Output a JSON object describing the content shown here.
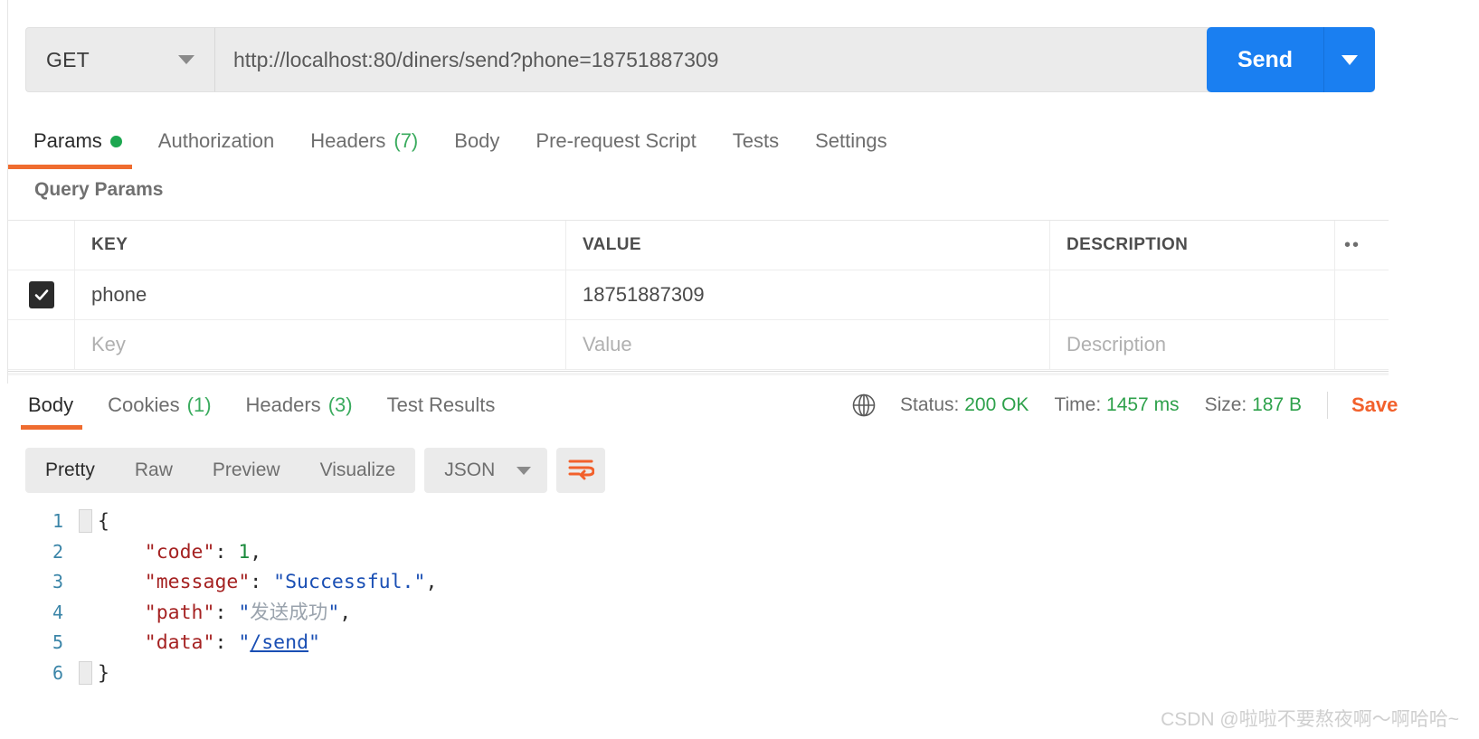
{
  "request": {
    "method": "GET",
    "method_caret_icon": "chevron-down-icon",
    "url": "http://localhost:80/diners/send?phone=18751887309",
    "send_label": "Send",
    "send_caret_icon": "chevron-down-icon"
  },
  "request_tabs": [
    {
      "label": "Params",
      "badge": "",
      "dot": true,
      "active": true
    },
    {
      "label": "Authorization",
      "badge": "",
      "dot": false,
      "active": false
    },
    {
      "label": "Headers",
      "badge": "(7)",
      "dot": false,
      "active": false
    },
    {
      "label": "Body",
      "badge": "",
      "dot": false,
      "active": false
    },
    {
      "label": "Pre-request Script",
      "badge": "",
      "dot": false,
      "active": false
    },
    {
      "label": "Tests",
      "badge": "",
      "dot": false,
      "active": false
    },
    {
      "label": "Settings",
      "badge": "",
      "dot": false,
      "active": false
    }
  ],
  "query_params": {
    "section_title": "Query Params",
    "columns": [
      "KEY",
      "VALUE",
      "DESCRIPTION"
    ],
    "bulk_edit_icon": "ellipsis-icon",
    "rows": [
      {
        "checked": true,
        "key": "phone",
        "value": "18751887309",
        "description": ""
      }
    ],
    "placeholder_row": {
      "key": "Key",
      "value": "Value",
      "description": "Description"
    }
  },
  "response_tabs": [
    {
      "label": "Body",
      "badge": "",
      "active": true
    },
    {
      "label": "Cookies",
      "badge": "(1)",
      "active": false
    },
    {
      "label": "Headers",
      "badge": "(3)",
      "active": false
    },
    {
      "label": "Test Results",
      "badge": "",
      "active": false
    }
  ],
  "response_status": {
    "globe_icon": "globe-icon",
    "status_label": "Status:",
    "status_value": "200 OK",
    "time_label": "Time:",
    "time_value": "1457 ms",
    "size_label": "Size:",
    "size_value": "187 B",
    "save_label": "Save",
    "accent_green": "#2ea14b",
    "accent_orange": "#f2612c"
  },
  "body_toolbar": {
    "views": [
      {
        "label": "Pretty",
        "active": true
      },
      {
        "label": "Raw",
        "active": false
      },
      {
        "label": "Preview",
        "active": false
      },
      {
        "label": "Visualize",
        "active": false
      }
    ],
    "format": "JSON",
    "format_caret_icon": "chevron-down-icon",
    "wrap_icon": "wrap-lines-icon"
  },
  "response_body": {
    "language": "json",
    "lines": [
      {
        "no": "1",
        "tokens": [
          {
            "t": "{",
            "c": "punct"
          }
        ]
      },
      {
        "no": "2",
        "tokens": [
          {
            "t": "    ",
            "c": "punct"
          },
          {
            "t": "\"code\"",
            "c": "key"
          },
          {
            "t": ": ",
            "c": "punct"
          },
          {
            "t": "1",
            "c": "num"
          },
          {
            "t": ",",
            "c": "punct"
          }
        ]
      },
      {
        "no": "3",
        "tokens": [
          {
            "t": "    ",
            "c": "punct"
          },
          {
            "t": "\"message\"",
            "c": "key"
          },
          {
            "t": ": ",
            "c": "punct"
          },
          {
            "t": "\"Successful.\"",
            "c": "str"
          },
          {
            "t": ",",
            "c": "punct"
          }
        ]
      },
      {
        "no": "4",
        "tokens": [
          {
            "t": "    ",
            "c": "punct"
          },
          {
            "t": "\"path\"",
            "c": "key"
          },
          {
            "t": ": ",
            "c": "punct"
          },
          {
            "t": "\"",
            "c": "str"
          },
          {
            "t": "发送成功",
            "c": "cjk"
          },
          {
            "t": "\"",
            "c": "str"
          },
          {
            "t": ",",
            "c": "punct"
          }
        ]
      },
      {
        "no": "5",
        "tokens": [
          {
            "t": "    ",
            "c": "punct"
          },
          {
            "t": "\"data\"",
            "c": "key"
          },
          {
            "t": ": ",
            "c": "punct"
          },
          {
            "t": "\"",
            "c": "str"
          },
          {
            "t": "/send",
            "c": "link"
          },
          {
            "t": "\"",
            "c": "str"
          }
        ]
      },
      {
        "no": "6",
        "tokens": [
          {
            "t": "}",
            "c": "punct"
          }
        ]
      }
    ]
  },
  "watermark": "CSDN @啦啦不要熬夜啊～啊哈哈~"
}
